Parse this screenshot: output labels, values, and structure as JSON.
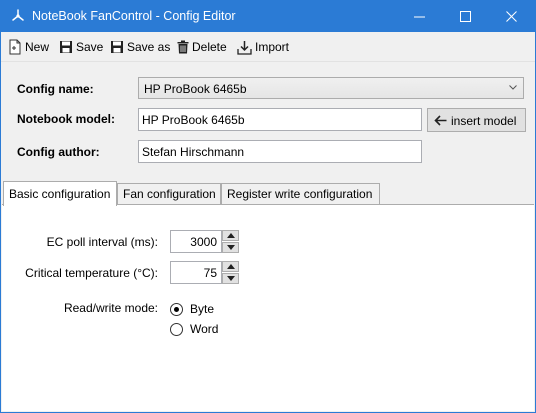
{
  "window": {
    "title": "NoteBook FanControl - Config Editor",
    "accent_color": "#2b7bd5",
    "controls": [
      "minimize-icon",
      "maximize-icon",
      "close-icon"
    ]
  },
  "toolbar": {
    "new_label": "New",
    "save_label": "Save",
    "save_as_label": "Save as",
    "delete_label": "Delete",
    "import_label": "Import"
  },
  "header": {
    "config_name_label": "Config name:",
    "config_name_value": "HP ProBook 6465b",
    "notebook_model_label": "Notebook model:",
    "notebook_model_value": "HP ProBook 6465b",
    "insert_model_label": "insert model",
    "config_author_label": "Config author:",
    "config_author_value": "Stefan Hirschmann"
  },
  "tabs": [
    {
      "label": "Basic configuration",
      "active": true
    },
    {
      "label": "Fan configuration",
      "active": false
    },
    {
      "label": "Register write configuration",
      "active": false
    }
  ],
  "basic": {
    "ec_poll_label": "EC poll interval (ms):",
    "ec_poll_value": "3000",
    "critical_temp_label": "Critical temperature (°C):",
    "critical_temp_value": "75",
    "rw_mode_label": "Read/write mode:",
    "rw_options": [
      {
        "label": "Byte",
        "selected": true
      },
      {
        "label": "Word",
        "selected": false
      }
    ]
  }
}
